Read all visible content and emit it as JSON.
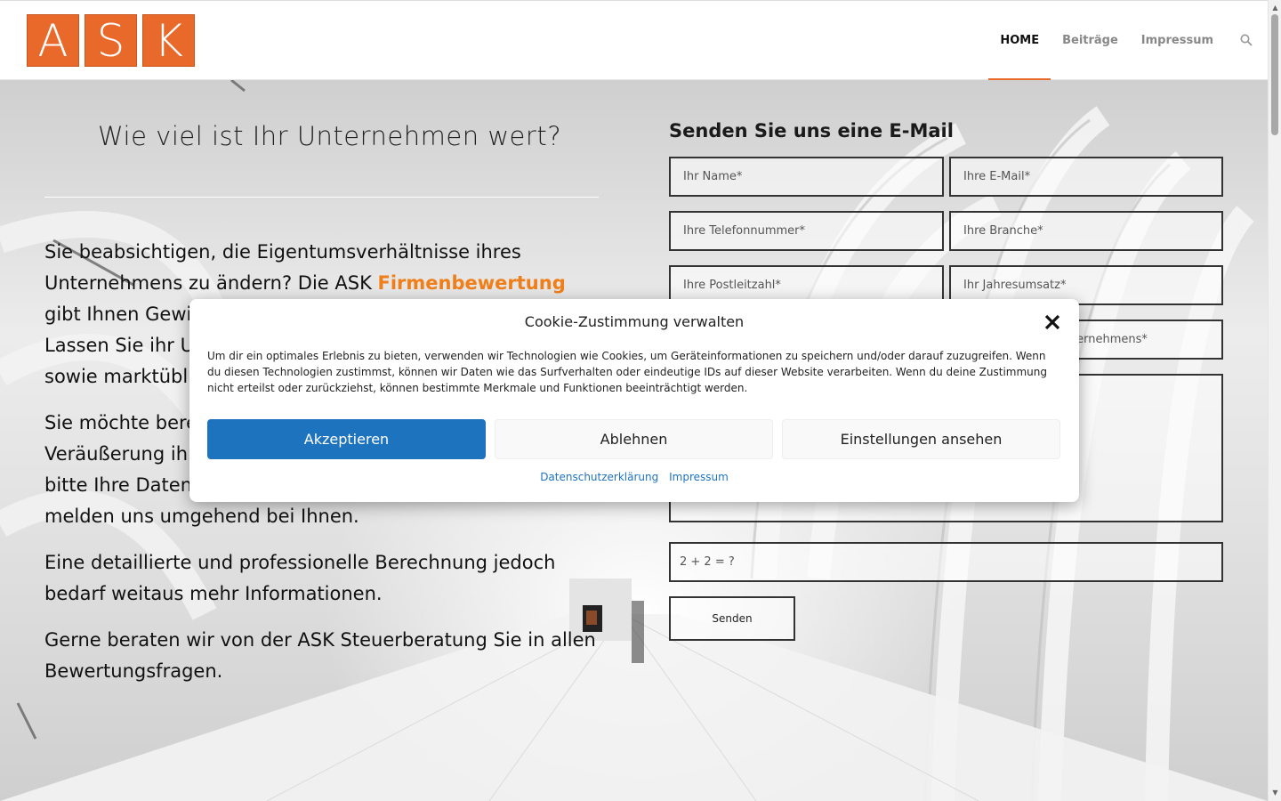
{
  "header": {
    "logo_letters": [
      "A",
      "S",
      "K"
    ],
    "nav": [
      {
        "label": "HOME",
        "active": true
      },
      {
        "label": "Beiträge",
        "active": false
      },
      {
        "label": "Impressum",
        "active": false
      }
    ],
    "search_icon": "search-icon",
    "accent_color": "#e8692a"
  },
  "hero": {
    "title": "Wie viel ist Ihr Unternehmen wert?",
    "p1_before": "Sie beabsichtigen, die Eigentumsverhältnisse ihres Unternehmens zu ändern? Die ASK ",
    "p1_highlight": "Firmenbewertung",
    "p1_after": " gibt Ihnen Gewi",
    "p1_line3": "Lassen Sie ihr U",
    "p1_line4": "sowie marktübl",
    "p2_line1": "Sie möchte bere",
    "p2_line2": "Veräußerung ih",
    "p2_line3": "bitte Ihre Daten",
    "p2_line4": "melden uns umgehend bei Ihnen.",
    "p3": "Eine detaillierte und professionelle Berechnung jedoch bedarf weitaus mehr Informationen.",
    "p4": "Gerne beraten wir von der ASK Steuerberatung Sie in allen Bewertungsfragen."
  },
  "form": {
    "title": "Senden Sie uns eine E-Mail",
    "name_placeholder": "Ihr Name*",
    "email_placeholder": "Ihre E-Mail*",
    "phone_placeholder": "Ihre Telefonnummer*",
    "branch_placeholder": "Ihre Branche*",
    "zip_placeholder": "Ihre Postleitzahl*",
    "revenue_placeholder": "Ihr Jahresumsatz*",
    "company_placeholder_visible": "ternehmens*",
    "captcha_label": "2 + 2 = ?",
    "submit_label": "Senden"
  },
  "cookie": {
    "title": "Cookie-Zustimmung verwalten",
    "text": "Um dir ein optimales Erlebnis zu bieten, verwenden wir Technologien wie Cookies, um Geräteinformationen zu speichern und/oder darauf zuzugreifen. Wenn du diesen Technologien zustimmst, können wir Daten wie das Surfverhalten oder eindeutige IDs auf dieser Website verarbeiten. Wenn du deine Zustimmung nicht erteilst oder zurückziehst, können bestimmte Merkmale und Funktionen beeinträchtigt werden.",
    "accept": "Akzeptieren",
    "decline": "Ablehnen",
    "settings": "Einstellungen ansehen",
    "privacy_link": "Datenschutzerklärung",
    "imprint_link": "Impressum",
    "primary_color": "#1e73be"
  }
}
